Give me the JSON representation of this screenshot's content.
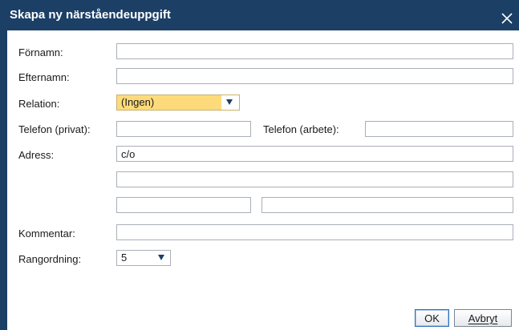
{
  "dialog": {
    "title": "Skapa ny närståendeuppgift"
  },
  "form": {
    "fornamn_label": "Förnamn:",
    "fornamn_value": "",
    "efternamn_label": "Efternamn:",
    "efternamn_value": "",
    "relation_label": "Relation:",
    "relation_value": "(Ingen)",
    "telefon_privat_label": "Telefon (privat):",
    "telefon_privat_value": "",
    "telefon_arbete_label": "Telefon (arbete):",
    "telefon_arbete_value": "",
    "adress_label": "Adress:",
    "adress_co_value": "c/o",
    "adress_line2_value": "",
    "postnummer_value": "",
    "ort_value": "",
    "kommentar_label": "Kommentar:",
    "kommentar_value": "",
    "rangordning_label": "Rangordning:",
    "rangordning_value": "5"
  },
  "buttons": {
    "ok_label": "OK",
    "cancel_label": "Avbryt"
  },
  "colors": {
    "titlebar": "#1c3f66",
    "relation_highlight": "#fddb7a",
    "dropdown_arrow": "#1c3f66",
    "field_border": "#a9b0b8"
  },
  "icons": {
    "close": "close-icon",
    "dropdown": "chevron-down-icon"
  }
}
